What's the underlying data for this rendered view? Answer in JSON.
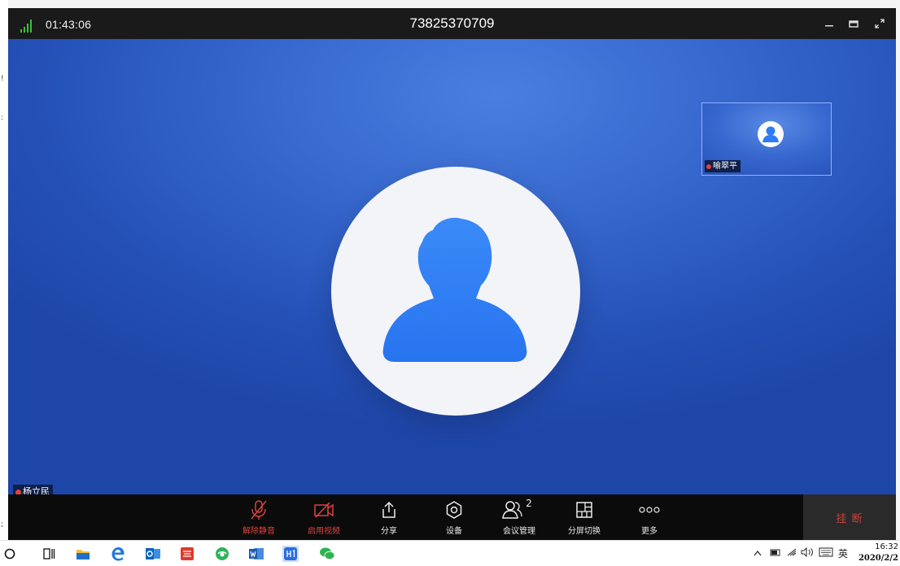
{
  "window": {
    "elapsed_time": "01:43:06",
    "meeting_id": "73825370709"
  },
  "stage": {
    "main_speaker": "杨立民",
    "main_speaker_muted": true
  },
  "thumbnail": {
    "participant": "喻翠平",
    "muted": true
  },
  "toolbar": {
    "items": [
      {
        "label": "解除静音",
        "icon": "mic-off-icon",
        "active_color": "#d9433c"
      },
      {
        "label": "启用视频",
        "icon": "video-off-icon",
        "active_color": "#d9433c"
      },
      {
        "label": "分享",
        "icon": "share-icon"
      },
      {
        "label": "设备",
        "icon": "settings-icon"
      },
      {
        "label": "会议管理",
        "icon": "participants-icon",
        "count": "2"
      },
      {
        "label": "分屏切换",
        "icon": "layout-icon"
      },
      {
        "label": "更多",
        "icon": "more-icon"
      }
    ],
    "hangup_label": "挂 断"
  },
  "taskbar": {
    "tray_ime": "英",
    "clock_time": "16:32",
    "clock_date": "2020/2/2"
  },
  "colors": {
    "stage_blue": "#2a5ac2",
    "toolbar_bg": "#0b0b0b",
    "danger_red": "#d9433c",
    "avatar_blue": "#2f7cf6"
  }
}
